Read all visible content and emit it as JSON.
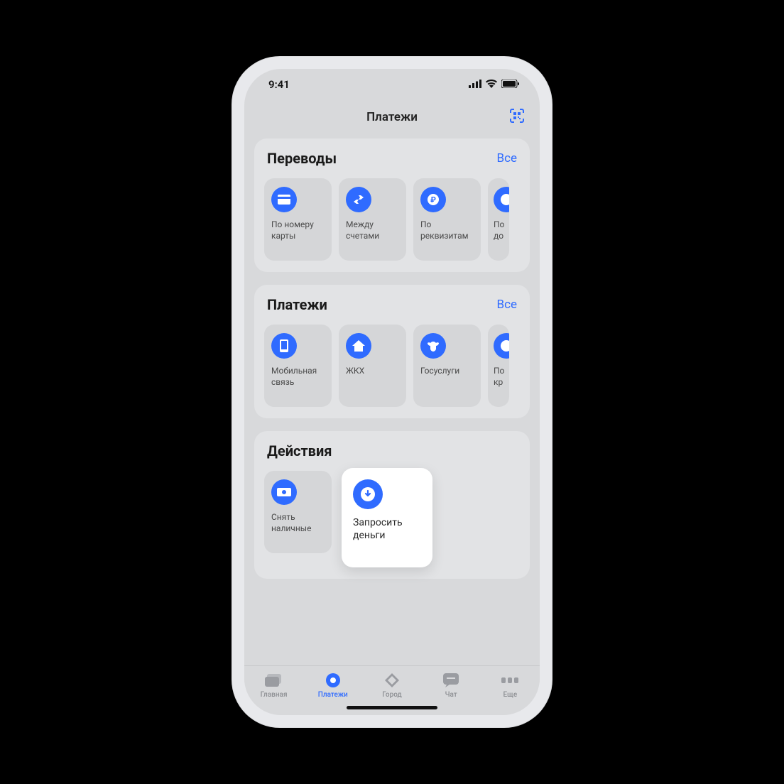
{
  "status": {
    "time": "9:41"
  },
  "header": {
    "title": "Платежи"
  },
  "sections": {
    "transfers": {
      "title": "Переводы",
      "all": "Все",
      "items": [
        {
          "label": "По номеру карты"
        },
        {
          "label": "Между счетами"
        },
        {
          "label": "По реквизитам"
        },
        {
          "label": "По до"
        }
      ]
    },
    "payments": {
      "title": "Платежи",
      "all": "Все",
      "items": [
        {
          "label": "Мобильная связь"
        },
        {
          "label": "ЖКХ"
        },
        {
          "label": "Госуслуги"
        },
        {
          "label": "По кр"
        }
      ]
    },
    "actions": {
      "title": "Действия",
      "items": [
        {
          "label": "Снять наличные"
        },
        {
          "label": "Запросить деньги",
          "highlight": true
        }
      ]
    }
  },
  "tabs": [
    {
      "label": "Главная"
    },
    {
      "label": "Платежи",
      "active": true
    },
    {
      "label": "Город"
    },
    {
      "label": "Чат"
    },
    {
      "label": "Еще"
    }
  ],
  "colors": {
    "accent": "#2f6bff"
  }
}
